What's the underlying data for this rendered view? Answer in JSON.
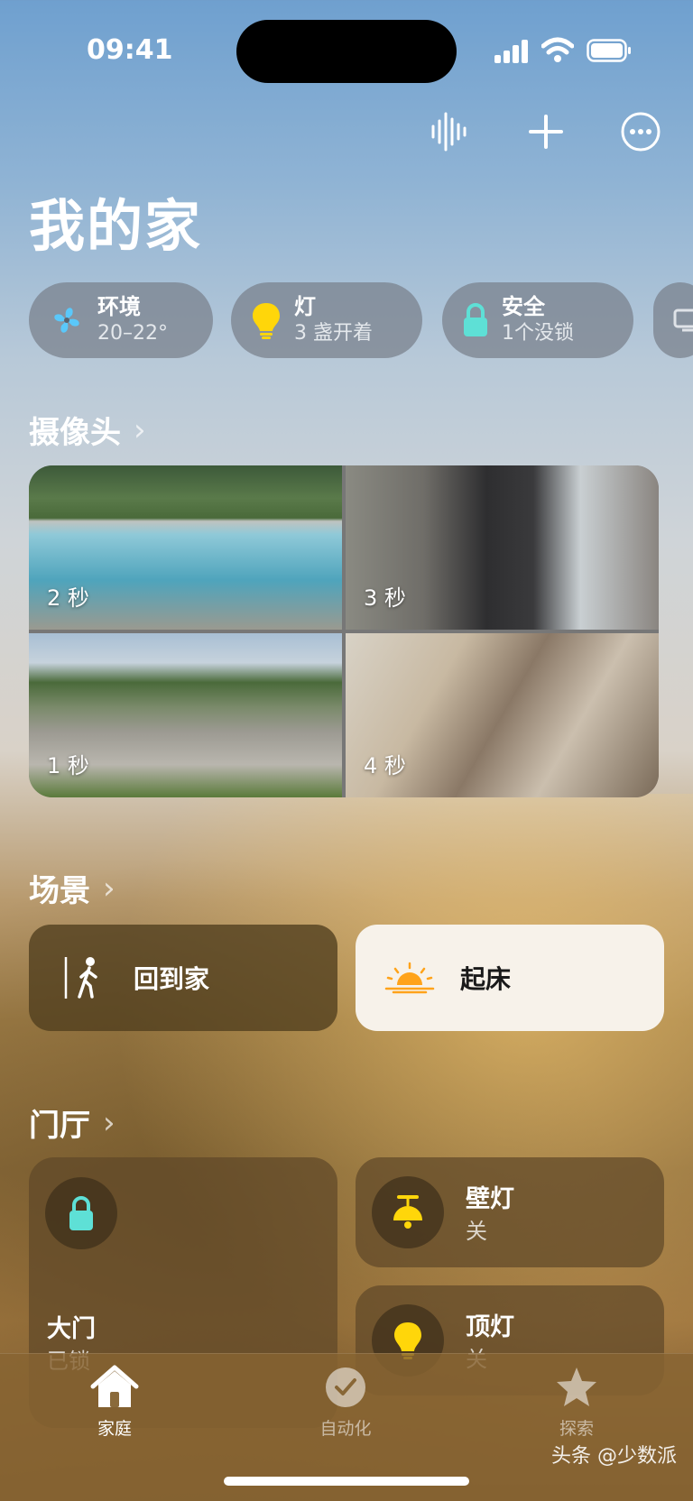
{
  "status_bar": {
    "time": "09:41"
  },
  "toolbar": {
    "icons": [
      "waveform-icon",
      "plus-icon",
      "ellipsis-circle-icon"
    ]
  },
  "page_title": "我的家",
  "summary_chips": [
    {
      "title": "环境",
      "subtitle": "20–22°",
      "icon": "fan-icon",
      "color": "#5ac8fa"
    },
    {
      "title": "灯",
      "subtitle": "3 盏开着",
      "icon": "bulb-icon",
      "color": "#ffd60a"
    },
    {
      "title": "安全",
      "subtitle": "1个没锁",
      "icon": "lock-icon",
      "color": "#5ee0d6"
    }
  ],
  "cameras": {
    "header": "摄像头",
    "feeds": [
      {
        "label": "2 秒"
      },
      {
        "label": "3 秒"
      },
      {
        "label": "1 秒"
      },
      {
        "label": "4 秒"
      }
    ]
  },
  "scenes": {
    "header": "场景",
    "items": [
      {
        "label": "回到家",
        "icon": "walking-person-icon",
        "active": false
      },
      {
        "label": "起床",
        "icon": "sunrise-icon",
        "active": true
      }
    ]
  },
  "room": {
    "header": "门厅",
    "accessories": [
      {
        "name": "大门",
        "state": "已锁",
        "icon": "lock-icon"
      },
      {
        "name": "壁灯",
        "state": "关",
        "icon": "ceiling-lamp-icon"
      },
      {
        "name": "顶灯",
        "state": "关",
        "icon": "bulb-icon"
      }
    ]
  },
  "tab_bar": {
    "tabs": [
      {
        "label": "家庭",
        "icon": "house-icon",
        "selected": true
      },
      {
        "label": "自动化",
        "icon": "clock-check-icon",
        "selected": false
      },
      {
        "label": "探索",
        "icon": "star-icon",
        "selected": false
      }
    ]
  },
  "watermark": "头条 @少数派"
}
